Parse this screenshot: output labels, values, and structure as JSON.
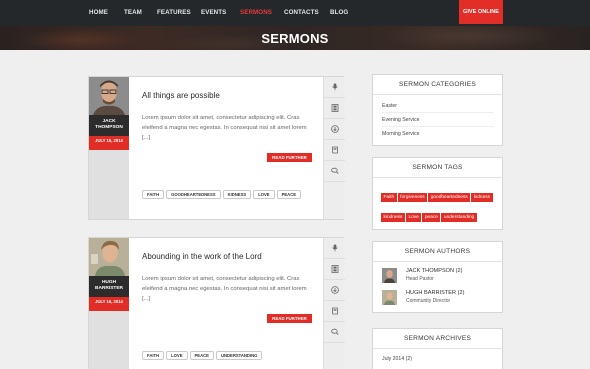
{
  "nav": {
    "items": [
      "HOME",
      "TEAM",
      "FEATURES",
      "EVENTS",
      "SERMONS",
      "CONTACTS",
      "BLOG"
    ],
    "active": "SERMONS",
    "give_button": "GIVE ONLINE"
  },
  "hero": {
    "title": "SERMONS"
  },
  "sermons": [
    {
      "title": "All things are possible",
      "excerpt": "Lorem ipsum dolor sit amet, consectetur adipiscing elit. Cras eleifend a magna nec egestas. In consequat nisi sit amet lorem [...]",
      "author": "JACK THOMPSON",
      "date": "JULY 15, 2014",
      "read_label": "READ FURTHER",
      "tags": [
        "FAITH",
        "GOODHEARTEDNESS",
        "KIDNESS",
        "LOVE",
        "PEACE"
      ]
    },
    {
      "title": "Abounding in the work of the Lord",
      "excerpt": "Lorem ipsum dolor sit amet, consectetur adipiscing elit. Cras eleifend a magna nec egestas. In consequat nisi sit amet lorem [...]",
      "author": "HUGH BARRISTER",
      "date": "JULY 16, 2014",
      "read_label": "READ FURTHER",
      "tags": [
        "FAITH",
        "LOVE",
        "PEACE",
        "UNDERSTANDING"
      ]
    }
  ],
  "side_icons": [
    "microphone-icon",
    "film-icon",
    "download-icon",
    "book-icon",
    "comments-icon"
  ],
  "sidebar": {
    "categories": {
      "title": "SERMON CATEGORIES",
      "items": [
        "Easter",
        "Evening Service",
        "Morning Service"
      ]
    },
    "tags": {
      "title": "SERMON TAGS",
      "items": [
        "Faith",
        "forgiveness",
        "goodheartedness",
        "kidness",
        "kindness",
        "Love",
        "peace",
        "understanding"
      ]
    },
    "authors": {
      "title": "SERMON AUTHORS",
      "items": [
        {
          "name": "JACK THOMPSON (2)",
          "role": "Head Pastor"
        },
        {
          "name": "HUGH BARRISTER (2)",
          "role": "Community Director"
        }
      ]
    },
    "archives": {
      "title": "SERMON ARCHIVES",
      "items": [
        "July 2014 (2)"
      ]
    }
  },
  "colors": {
    "accent": "#e22c26",
    "nav_bg": "#25282b",
    "page_bg": "#efefef"
  }
}
